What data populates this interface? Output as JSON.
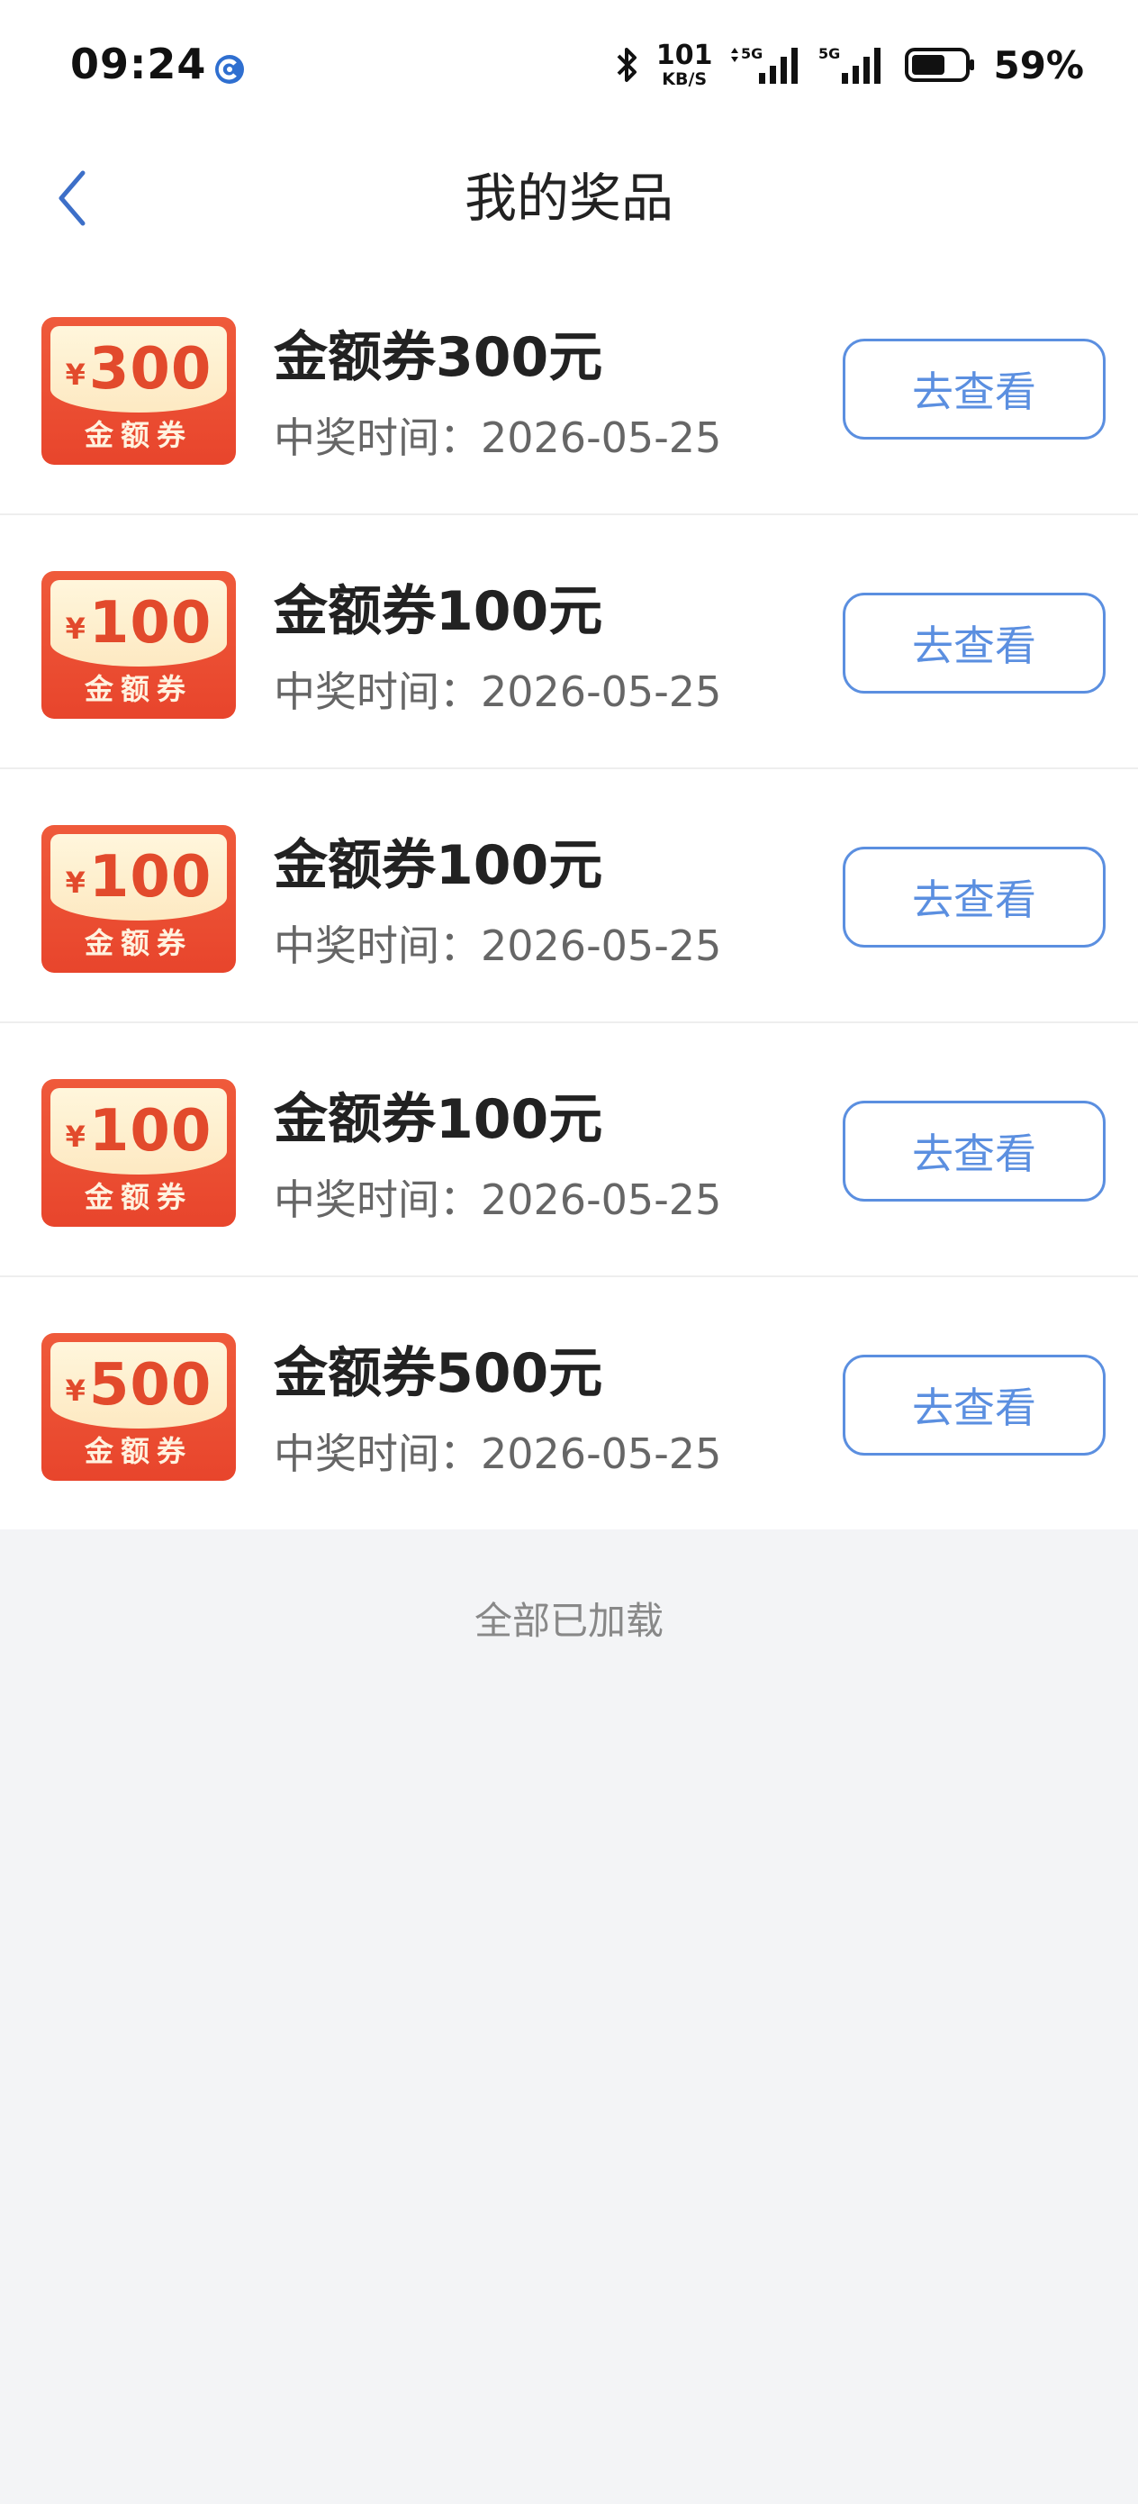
{
  "status_bar": {
    "time": "09:24",
    "net_speed_value": "101",
    "net_speed_unit": "KB/S",
    "battery_percent": "59%",
    "signal_1_label": "5G",
    "signal_2_label": "5G"
  },
  "header": {
    "title": "我的奖品"
  },
  "prizes": [
    {
      "badge_currency": "¥",
      "badge_amount": "300",
      "badge_label": "金额券",
      "title": "金额券300元",
      "date_text": "中奖时间：2026-05-25",
      "action_label": "去查看"
    },
    {
      "badge_currency": "¥",
      "badge_amount": "100",
      "badge_label": "金额券",
      "title": "金额券100元",
      "date_text": "中奖时间：2026-05-25",
      "action_label": "去查看"
    },
    {
      "badge_currency": "¥",
      "badge_amount": "100",
      "badge_label": "金额券",
      "title": "金额券100元",
      "date_text": "中奖时间：2026-05-25",
      "action_label": "去查看"
    },
    {
      "badge_currency": "¥",
      "badge_amount": "100",
      "badge_label": "金额券",
      "title": "金额券100元",
      "date_text": "中奖时间：2026-05-25",
      "action_label": "去查看"
    },
    {
      "badge_currency": "¥",
      "badge_amount": "500",
      "badge_label": "金额券",
      "title": "金额券500元",
      "date_text": "中奖时间：2026-05-25",
      "action_label": "去查看"
    }
  ],
  "footer": {
    "note": "全部已加载"
  },
  "colors": {
    "accent_blue": "#5b8fe0",
    "coupon_red": "#e8452c",
    "coupon_cream": "#fde9c2",
    "page_background": "#f3f4f6"
  },
  "icons": {
    "back": "chevron-left-icon",
    "bluetooth": "bluetooth-icon",
    "signal": "cellular-signal-icon",
    "battery": "battery-icon",
    "app_indicator": "app-notification-icon"
  }
}
